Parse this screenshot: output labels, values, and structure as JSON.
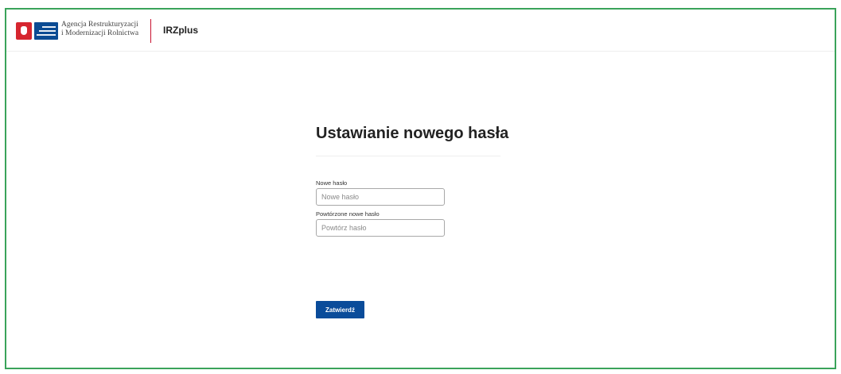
{
  "header": {
    "agency_line1": "Agencja Restrukturyzacji",
    "agency_line2": "i Modernizacji Rolnictwa",
    "app_name": "IRZplus",
    "accent_color": "#c8102e"
  },
  "form": {
    "title": "Ustawianie nowego hasła",
    "new_password_label": "Nowe hasło",
    "new_password_placeholder": "Nowe hasło",
    "repeat_password_label": "Powtórzone nowe hasło",
    "repeat_password_placeholder": "Powtórz hasło",
    "submit_label": "Zatwierdź",
    "button_color": "#0a4c9a"
  },
  "frame_color": "#3aa35a"
}
